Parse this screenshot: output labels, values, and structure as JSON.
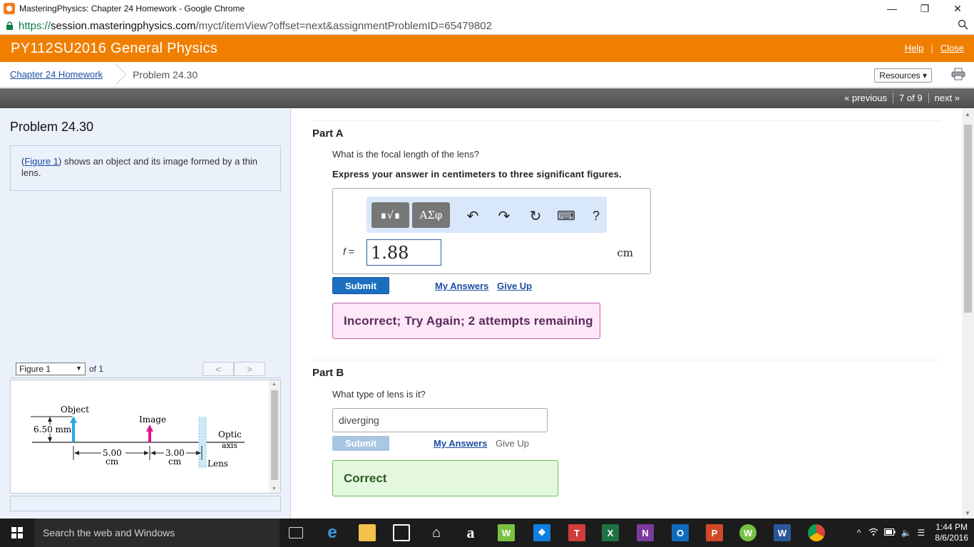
{
  "window": {
    "title": "MasteringPhysics: Chapter 24 Homework - Google Chrome",
    "minimize": "—",
    "restore": "❐",
    "close": "✕"
  },
  "address": {
    "scheme": "https://",
    "host": "session.masteringphysics.com",
    "path": "/myct/itemView?offset=next&assignmentProblemID=65479802",
    "zoom_icon": "magnifier-icon"
  },
  "header": {
    "course_title": "PY112SU2016 General Physics",
    "help_label": "Help",
    "separator": "|",
    "close_label": "Close"
  },
  "breadcrumb": {
    "homework_link": "Chapter 24 Homework",
    "current": "Problem 24.30",
    "resources_label": "Resources ▾"
  },
  "pager": {
    "previous": "« previous",
    "position": "7 of 9",
    "next": "next »"
  },
  "left": {
    "problem_title": "Problem 24.30",
    "intro_paren_open": "(",
    "figure_link": "Figure 1",
    "intro_text": ") shows an object and its image formed by a thin lens.",
    "figure_select": "Figure 1",
    "select_arrow": "▼",
    "figure_of": "of 1",
    "prev_fig": "<",
    "next_fig": ">",
    "scroll_up": "▲",
    "scroll_down": "▼",
    "figure": {
      "object_label": "Object",
      "image_label": "Image",
      "height_label": "6.50 mm",
      "optic_label": "Optic",
      "axis_label": "axis",
      "lens_label": "Lens",
      "dist1_value": "5.00",
      "dist1_unit": "cm",
      "dist2_value": "3.00",
      "dist2_unit": "cm"
    }
  },
  "partA": {
    "label": "Part A",
    "question": "What is the focal length of the lens?",
    "instruction": "Express your answer in centimeters to three significant figures.",
    "toolbar": {
      "templates_label": "∎√∎",
      "symbols_label": "ΑΣφ",
      "undo": "↶",
      "redo": "↷",
      "reset": "↻",
      "keyboard_label": "⌨",
      "help": "?"
    },
    "variable": "f",
    "equals": " =",
    "answer_value": "1.88",
    "unit": "cm",
    "submit_label": "Submit",
    "my_answers_label": "My Answers",
    "give_up_label": "Give Up",
    "feedback": "Incorrect; Try Again; 2 attempts remaining"
  },
  "partB": {
    "label": "Part B",
    "question": "What type of lens is it?",
    "answer_value": "diverging",
    "submit_label": "Submit",
    "my_answers_label": "My Answers",
    "give_up_label": "Give Up",
    "feedback": "Correct"
  },
  "scrollbar": {
    "up": "▲",
    "down": "▼"
  },
  "taskbar": {
    "search_placeholder": "Search the web and Windows",
    "time": "1:44 PM",
    "date": "8/6/2016",
    "apps": {
      "edge": "e",
      "amazon": "a",
      "w": "W",
      "t": "T",
      "excel": "X",
      "onenote": "N",
      "outlook": "O",
      "powerpoint": "P",
      "wsign": "W",
      "word": "W"
    },
    "tray": {
      "chevron": "^",
      "volume": "🔈",
      "notification": "☰"
    }
  },
  "colors": {
    "header_orange": "#f07f00",
    "link_blue": "#1a4fa3",
    "submit_blue": "#1b6fbf",
    "incorrect_bg": "#fce8f8",
    "correct_bg": "#e4f8e0",
    "object_arrow": "#29a8e0",
    "image_arrow": "#e0178b"
  }
}
